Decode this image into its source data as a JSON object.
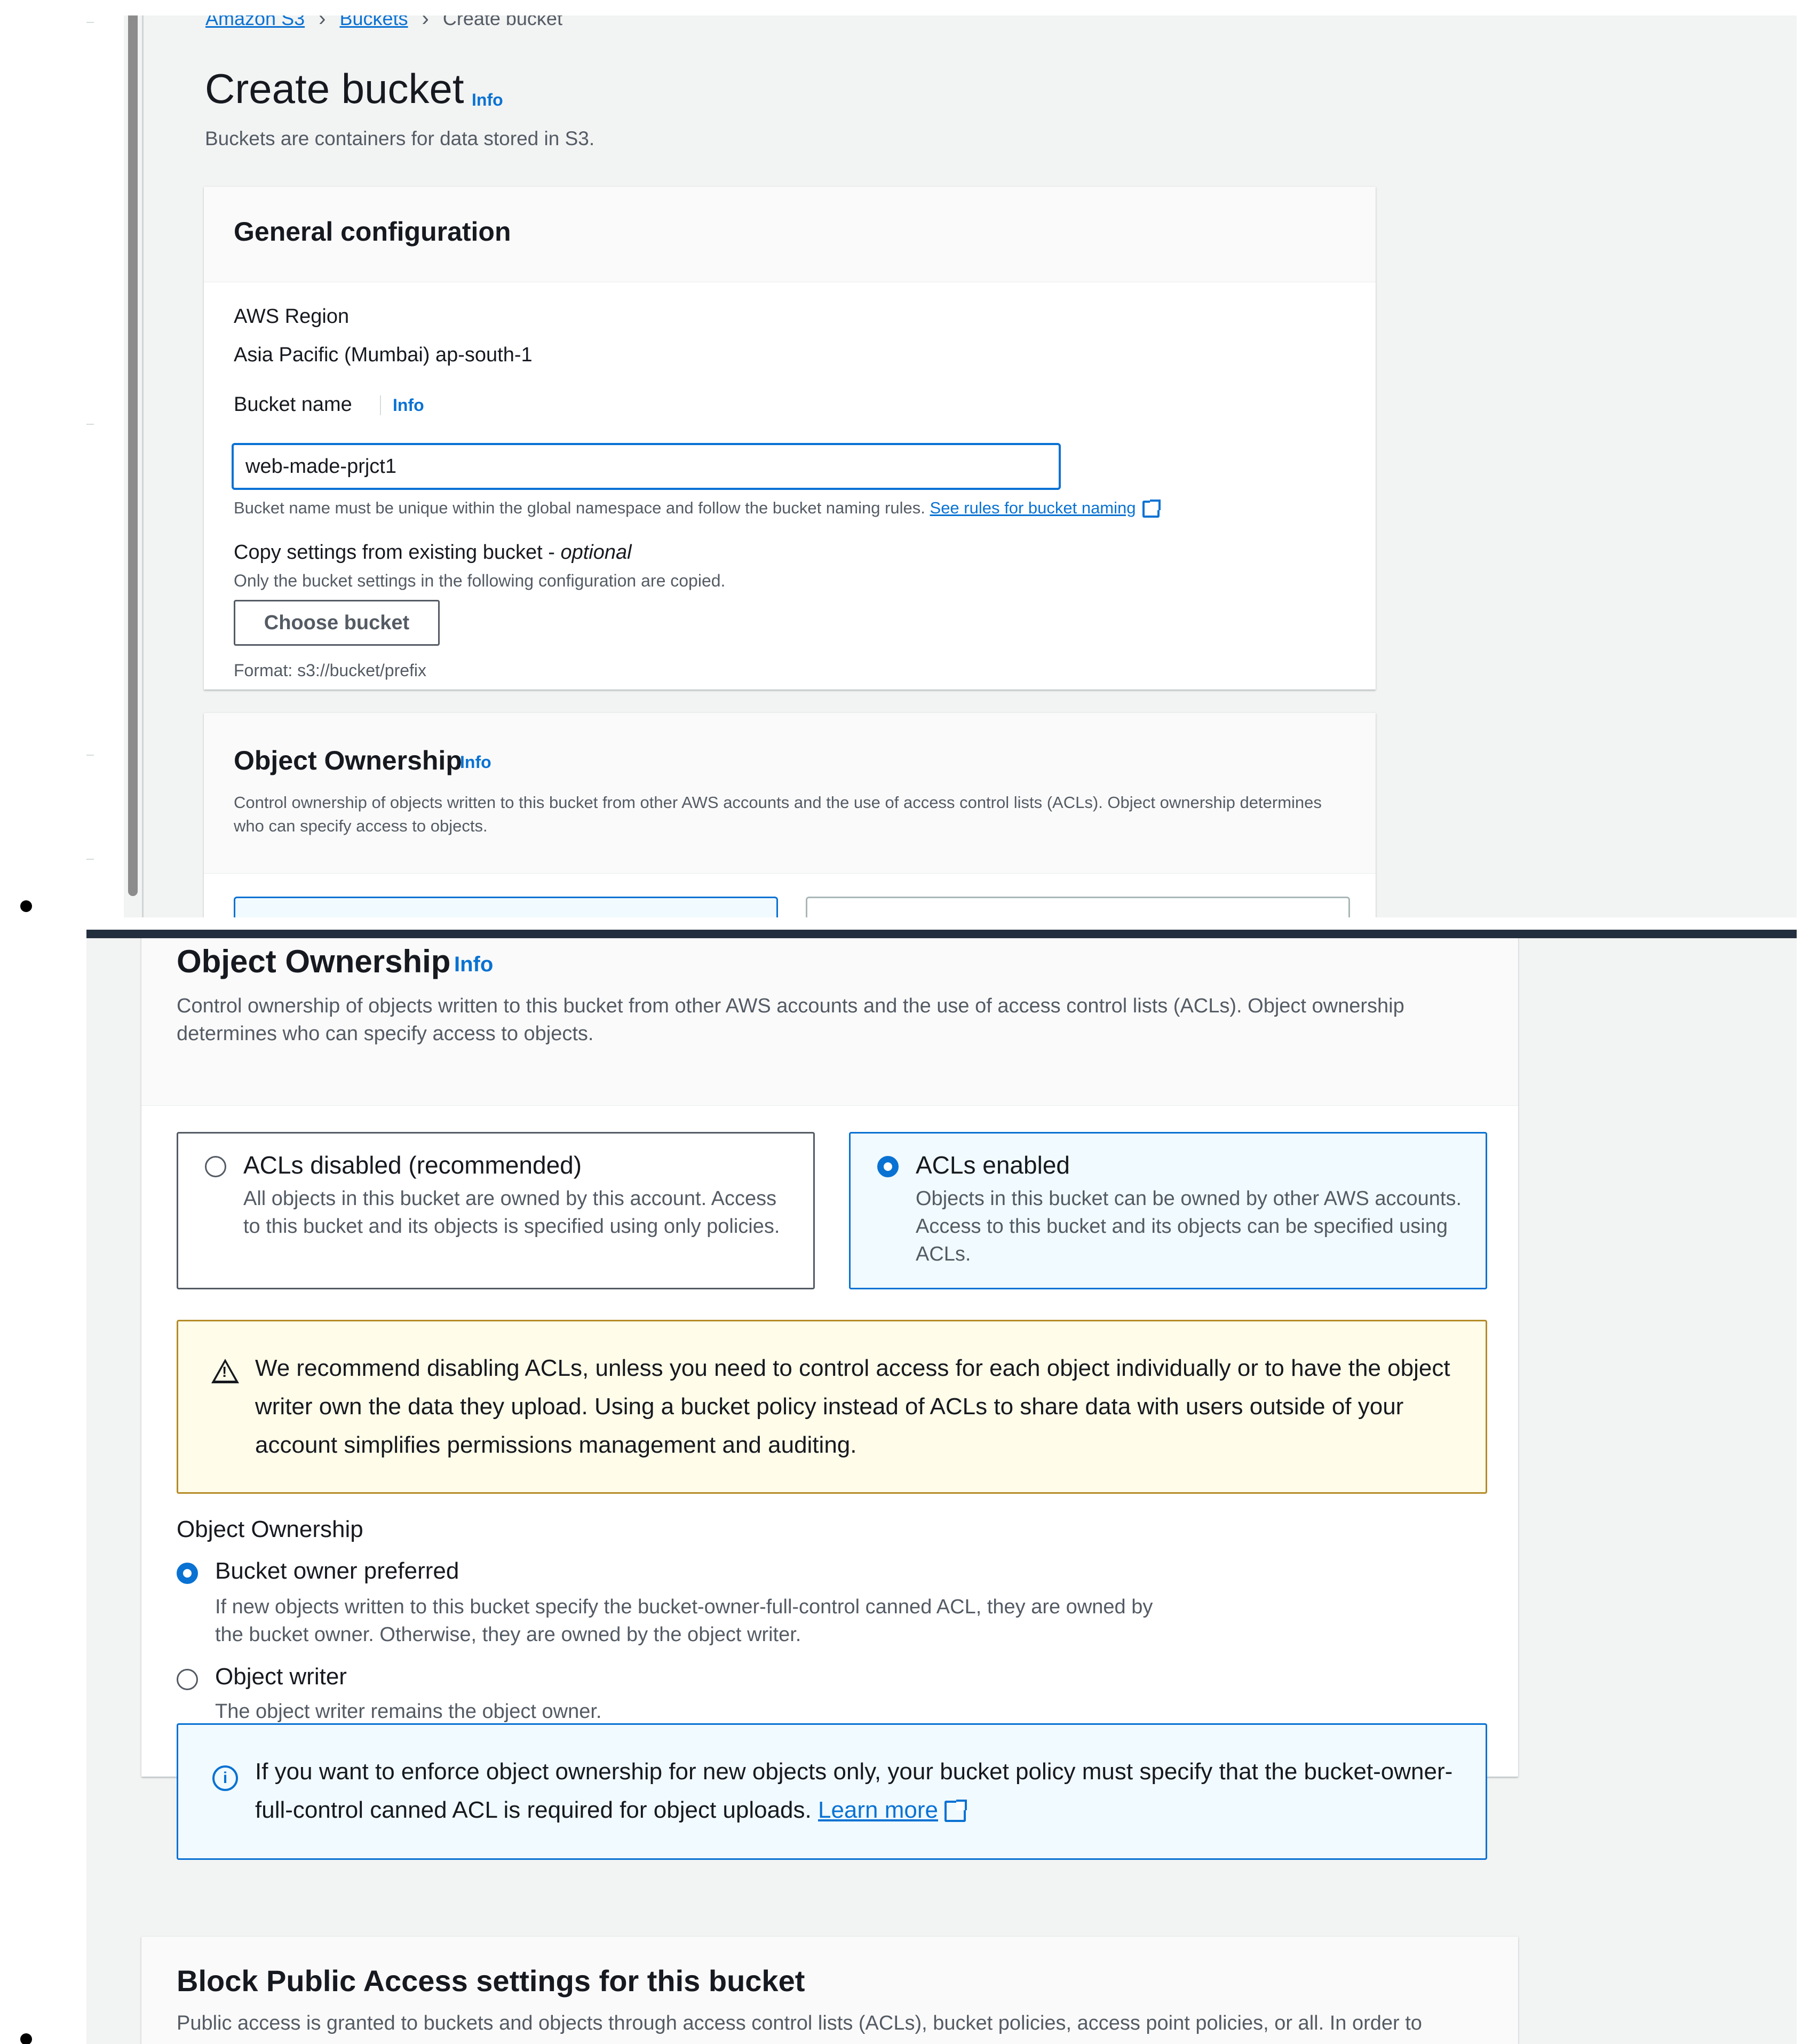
{
  "breadcrumb": {
    "items": [
      "Amazon S3",
      "Buckets",
      "Create bucket"
    ]
  },
  "page": {
    "title": "Create bucket",
    "info": "Info",
    "subtitle": "Buckets are containers for data stored in S3."
  },
  "general_config": {
    "title": "General configuration",
    "region_label": "AWS Region",
    "region_value": "Asia Pacific (Mumbai) ap-south-1",
    "bucket_name_label": "Bucket name",
    "bucket_name_info": "Info",
    "bucket_name_value": "web-made-prjct1",
    "bucket_name_hint": "Bucket name must be unique within the global namespace and follow the bucket naming rules.",
    "bucket_name_hint_link": "See rules for bucket naming",
    "copy_label": "Copy settings from existing bucket - ",
    "copy_optional": "optional",
    "copy_sub": "Only the bucket settings in the following configuration are copied.",
    "choose_button": "Choose bucket",
    "format": "Format: s3://bucket/prefix"
  },
  "object_ownership": {
    "title": "Object Ownership",
    "info": "Info",
    "description": "Control ownership of objects written to this bucket from other AWS accounts and the use of access control lists (ACLs). Object ownership determines who can specify access to objects.",
    "tiles": [
      {
        "label": "ACLs disabled (recommended)",
        "description": "All objects in this bucket are owned by this account. Access to this bucket and its objects is specified using only policies."
      },
      {
        "label": "ACLs enabled",
        "description": "Objects in this bucket can be owned by other AWS accounts. Access to this bucket and its objects can be specified using ACLs."
      }
    ],
    "selected_tile_first_view": 0,
    "selected_tile_second_view": 1,
    "warning": "We recommend disabling ACLs, unless you need to control access for each object individually or to have the object writer own the data they upload. Using a bucket policy instead of ACLs to share data with users outside of your account simplifies permissions management and auditing.",
    "ownership_label": "Object Ownership",
    "options": [
      {
        "label": "Bucket owner preferred",
        "description": "If new objects written to this bucket specify the bucket-owner-full-control canned ACL, they are owned by the bucket owner. Otherwise, they are owned by the object writer."
      },
      {
        "label": "Object writer",
        "description": "The object writer remains the object owner."
      }
    ],
    "selected_option": 0,
    "info_alert": "If you want to enforce object ownership for new objects only, your bucket policy must specify that the bucket-owner-full-control canned ACL is required for object uploads.",
    "info_alert_link": "Learn more"
  },
  "block_public_access": {
    "title": "Block Public Access settings for this bucket",
    "description": "Public access is granted to buckets and objects through access control lists (ACLs), bucket policies, access point policies, or all. In order to"
  },
  "icons": {
    "external_link": "external-link-icon",
    "warning": "warning-icon",
    "info": "info-icon"
  },
  "colors": {
    "link": "#0972d3",
    "page_bg": "#f2f3f3",
    "warning_border": "#b58b28",
    "warning_bg": "#fffce9",
    "info_bg": "#f1faff",
    "divider": "#232f3e"
  }
}
